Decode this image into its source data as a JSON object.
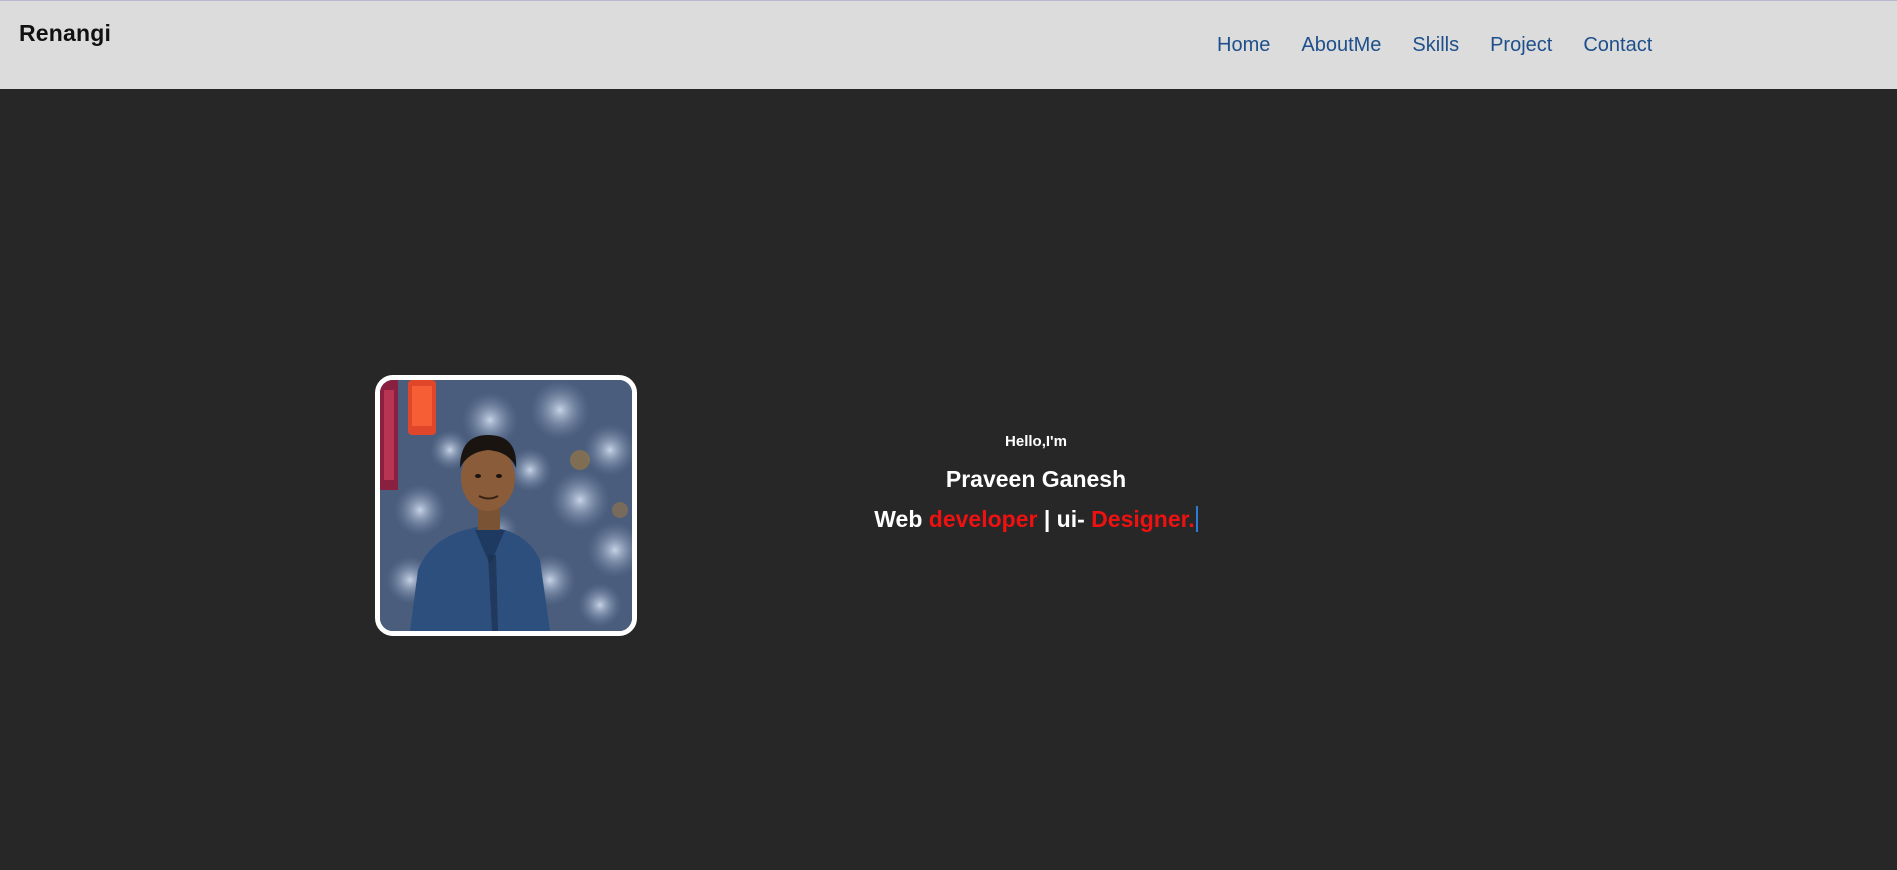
{
  "brand": {
    "name": "Renangi"
  },
  "nav": {
    "items": [
      {
        "label": "Home"
      },
      {
        "label": "AboutMe"
      },
      {
        "label": "Skills"
      },
      {
        "label": "Project"
      },
      {
        "label": "Contact"
      }
    ]
  },
  "hero": {
    "greeting": "Hello,I'm",
    "name": "Praveen Ganesh",
    "roles": {
      "part1": "Web ",
      "part2": "developer",
      "part3": " | ui- ",
      "part4": "Designer."
    }
  },
  "colors": {
    "nav_background": "#dcdcdc",
    "page_background": "#272727",
    "link": "#1e4f8a",
    "accent_red": "#ee1111",
    "text_white": "#ffffff"
  }
}
